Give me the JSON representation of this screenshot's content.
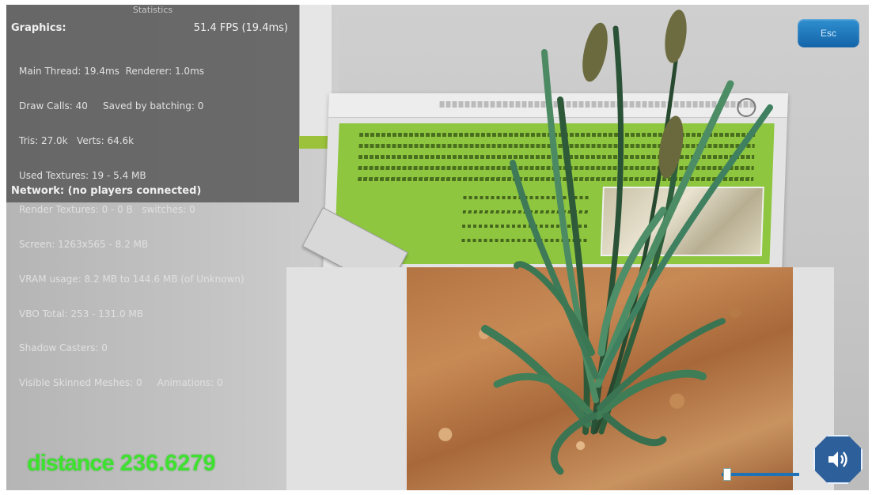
{
  "stats_panel": {
    "title": "Statistics",
    "graphics_label": "Graphics:",
    "fps": "51.4 FPS (19.4ms)",
    "lines": [
      "Main Thread: 19.4ms  Renderer: 1.0ms",
      "Draw Calls: 40     Saved by batching: 0",
      "Tris: 27.0k   Verts: 64.6k",
      "Used Textures: 19 - 5.4 MB",
      "Render Textures: 0 - 0 B   switches: 0",
      "Screen: 1263x565 - 8.2 MB",
      "VRAM usage: 8.2 MB to 144.6 MB (of Unknown)",
      "VBO Total: 253 - 131.0 MB",
      "Shadow Casters: 0",
      "Visible Skinned Meshes: 0     Animations: 0"
    ],
    "network": "Network: (no players connected)"
  },
  "toolbar": {
    "esc_label": "Esc"
  },
  "hud": {
    "distance_label": "distance",
    "distance_value": "236.6279",
    "volume_level": 0.02
  },
  "icons": {
    "sound": "speaker-volume-icon"
  },
  "colors": {
    "distance_text": "#3ee12f",
    "esc_button": "#1a74bb",
    "card_green": "#8ec63f",
    "sound_button": "#2d5f9a"
  }
}
